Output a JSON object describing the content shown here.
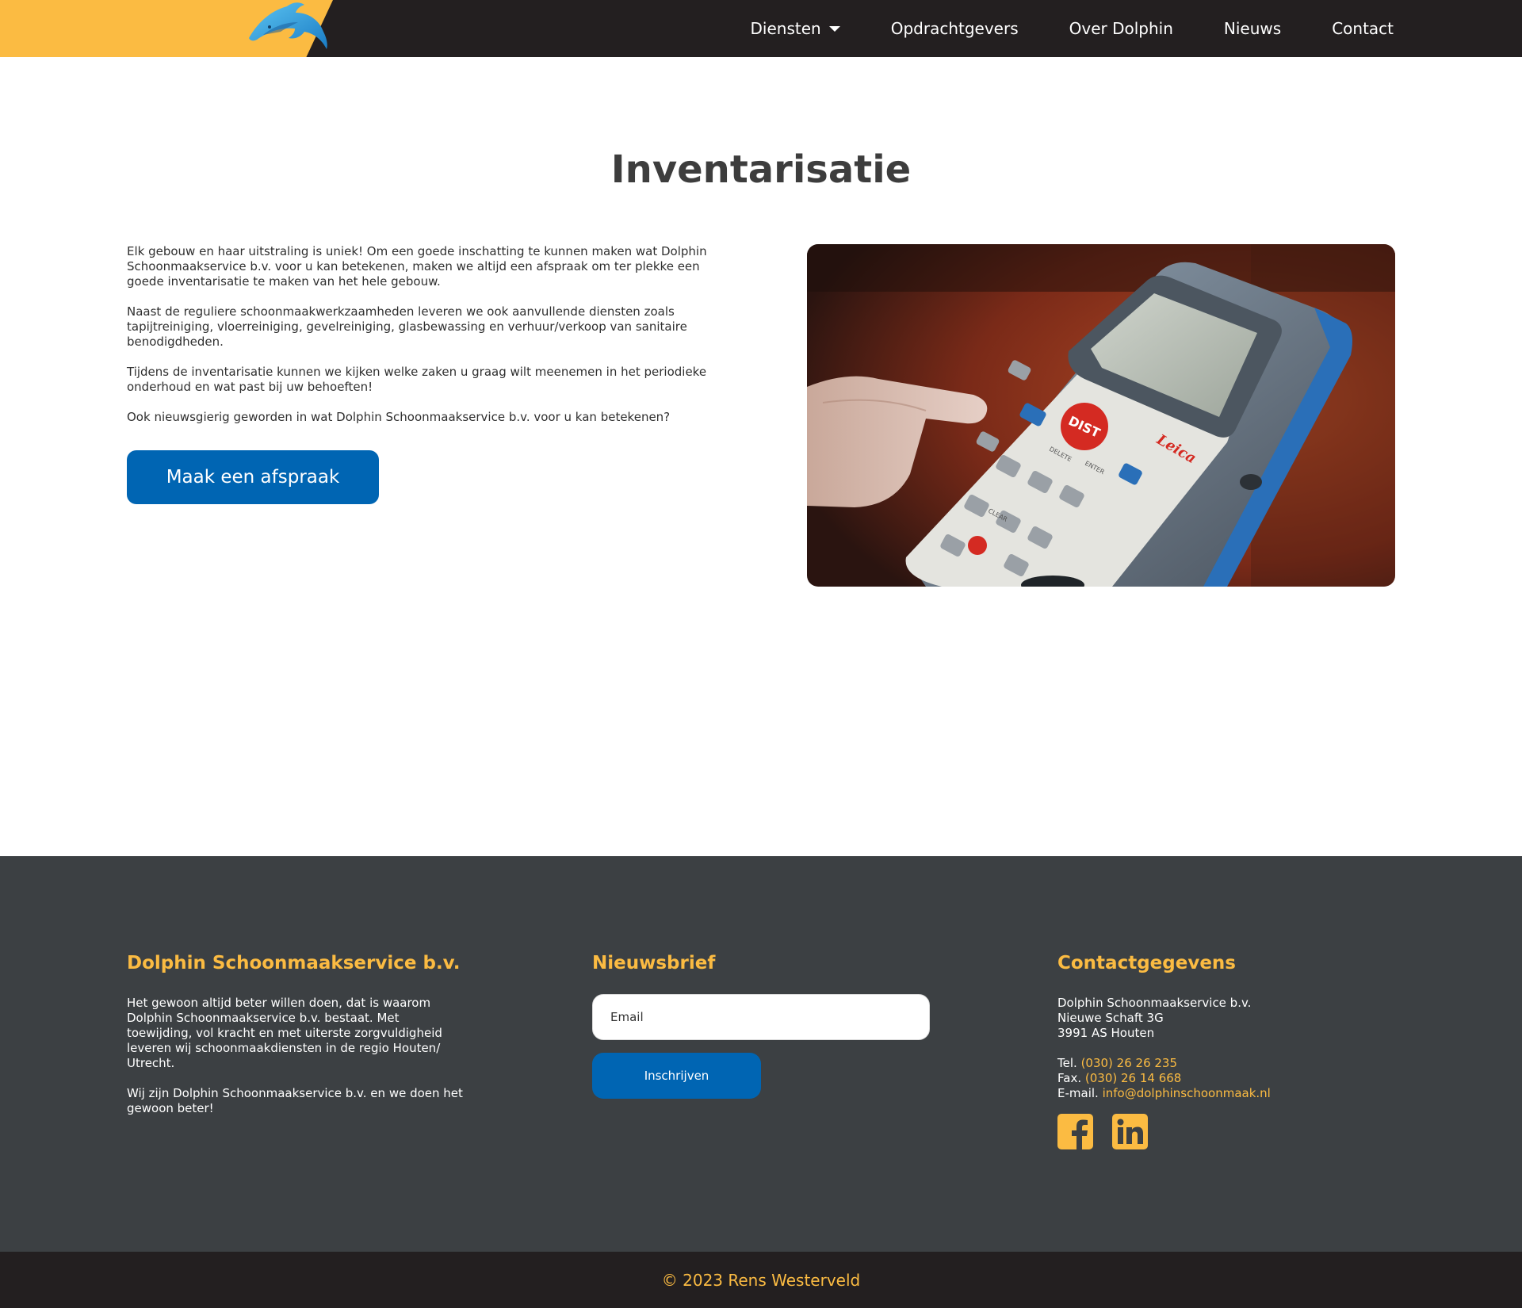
{
  "nav": {
    "items": [
      {
        "label": "Diensten",
        "has_dropdown": true
      },
      {
        "label": "Opdrachtgevers"
      },
      {
        "label": "Over Dolphin"
      },
      {
        "label": "Nieuws"
      },
      {
        "label": "Contact"
      }
    ],
    "logo_icon": "dolphin-logo"
  },
  "main": {
    "title": "Inventarisatie",
    "paragraphs": [
      "Elk gebouw en haar uitstraling is uniek! Om een goede inschatting te kunnen maken wat Dolphin Schoonmaakservice b.v. voor u kan betekenen, maken we altijd een afspraak om ter plekke een goede inventarisatie te maken van het hele gebouw.",
      "Naast de reguliere schoonmaakwerkzaamheden leveren we ook aanvullende diensten zoals tapijtreiniging, vloerreiniging, gevelreiniging, glasbewassing en verhuur/verkoop van sanitaire benodigdheden.",
      "Tijdens de inventarisatie kunnen we kijken welke zaken u graag wilt meenemen in het periodieke onderhoud en wat past bij uw behoeften!",
      "Ook nieuwsgierig geworden in wat Dolphin Schoonmaakservice b.v. voor u kan betekenen?"
    ],
    "cta_label": "Maak een afspraak",
    "image": {
      "device_brand": "Leica",
      "button_labels": {
        "dist": "DIST",
        "delete": "DELETE",
        "enter": "ENTER",
        "clear": "CLEAR"
      }
    }
  },
  "footer": {
    "about": {
      "heading": "Dolphin Schoonmaakservice b.v.",
      "paragraphs": [
        "Het gewoon altijd beter willen doen, dat is waarom Dolphin Schoonmaakservice b.v. bestaat. Met toewijding, vol kracht en met uiterste zorgvuldigheid leveren wij schoonmaakdiensten in de regio Houten/ Utrecht.",
        "Wij zijn Dolphin Schoonmaakservice b.v. en we doen het gewoon beter!"
      ]
    },
    "newsletter": {
      "heading": "Nieuwsbrief",
      "email_placeholder": "Email",
      "subscribe_label": "Inschrijven"
    },
    "contact": {
      "heading": "Contactgegevens",
      "company": "Dolphin Schoonmaakservice b.v.",
      "street": "Nieuwe Schaft 3G",
      "city": "3991 AS Houten",
      "tel_label": "Tel.",
      "tel": "(030) 26 26 235",
      "fax_label": "Fax.",
      "fax": "(030) 26 14 668",
      "email_label": "E-mail.",
      "email": "info@dolphinschoonmaak.nl",
      "social": [
        "facebook-icon",
        "linkedin-icon"
      ]
    }
  },
  "copyright": "© 2023 Rens Westerveld",
  "colors": {
    "accent": "#fbbb42",
    "primary_button": "#0065b3",
    "nav_bg": "#231f20",
    "footer_bg": "#3c4043"
  }
}
